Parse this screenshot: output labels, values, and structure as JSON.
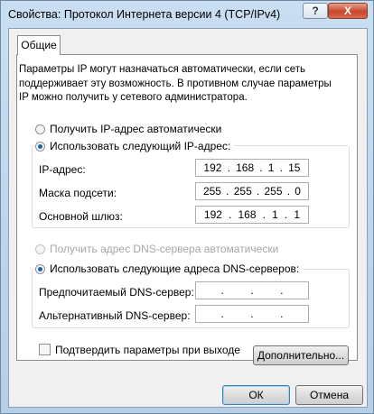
{
  "window": {
    "title": "Свойства: Протокол Интернета версии 4 (TCP/IPv4)",
    "help_label": "?",
    "close_label": "X"
  },
  "tabs": [
    {
      "label": "Общие"
    }
  ],
  "description": "Параметры IP могут назначаться автоматически, если сеть поддерживает эту возможность. В противном случае параметры IP можно получить у сетевого администратора.",
  "ip_mode": {
    "auto_label": "Получить IP-адрес автоматически",
    "manual_label": "Использовать следующий IP-адрес:",
    "selected": "manual"
  },
  "ip_fields": [
    {
      "label": "IP-адрес:",
      "octets": [
        "192",
        "168",
        "1",
        "15"
      ]
    },
    {
      "label": "Маска подсети:",
      "octets": [
        "255",
        "255",
        "255",
        "0"
      ]
    },
    {
      "label": "Основной шлюз:",
      "octets": [
        "192",
        "168",
        "1",
        "1"
      ]
    }
  ],
  "dns_mode": {
    "auto_label": "Получить адрес DNS-сервера автоматически",
    "manual_label": "Использовать следующие адреса DNS-серверов:",
    "selected": "manual"
  },
  "dns_fields": [
    {
      "label": "Предпочитаемый DNS-сервер:",
      "octets": [
        "",
        "",
        "",
        ""
      ]
    },
    {
      "label": "Альтернативный DNS-сервер:",
      "octets": [
        "",
        "",
        "",
        ""
      ]
    }
  ],
  "validate_on_exit": {
    "label": "Подтвердить параметры при выходе",
    "checked": false
  },
  "buttons": {
    "advanced": "Дополнительно...",
    "ok": "ОК",
    "cancel": "Отмена"
  },
  "colors": {
    "close_button": "#c8452d",
    "radio_selected": "#1c5fae",
    "disabled_text": "#a6a6a6"
  }
}
